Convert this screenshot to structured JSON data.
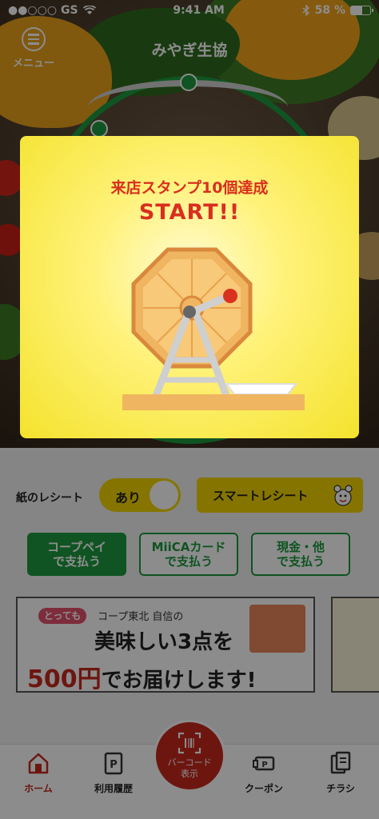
{
  "status_bar": {
    "carrier": "●●○○○ GS",
    "time": "9:41 AM",
    "battery": "58 %",
    "battery_level": 0.58
  },
  "header": {
    "menu_label": "メニュー",
    "app_title": "みやぎ生協"
  },
  "modal": {
    "title": "来店スタンプ10個達成",
    "start": "START!!"
  },
  "receipt": {
    "label": "紙のレシート",
    "toggle_value": "あり",
    "smart_receipt": "スマートレシート"
  },
  "payment": [
    {
      "line1": "コープペイ",
      "line2": "で支払う"
    },
    {
      "line1": "MiiCAカード",
      "line2": "で支払う"
    },
    {
      "line1": "現金・他",
      "line2": "で支払う"
    }
  ],
  "banner": {
    "badge": "とっても",
    "line1": "コープ東北 自信の",
    "line2": "美味しい3点を",
    "line3_price": "500円",
    "line3_rest": "でお届けします!"
  },
  "tabbar": {
    "home": "ホーム",
    "history": "利用履歴",
    "barcode_line1": "バーコード",
    "barcode_line2": "表示",
    "coupon": "クーポン",
    "flyer": "チラシ"
  },
  "colors": {
    "brand_green": "#1d9a3f",
    "accent_red": "#c6281e",
    "accent_yellow": "#f2d500"
  }
}
